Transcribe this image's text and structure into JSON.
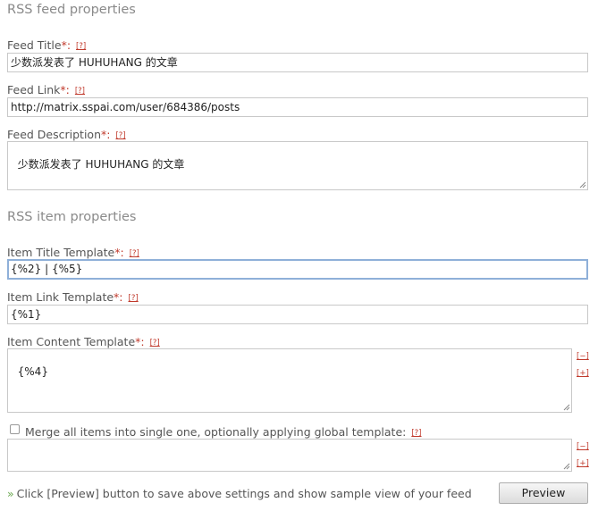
{
  "feed_section": {
    "title": "RSS feed properties",
    "feed_title": {
      "label": "Feed Title",
      "value": "少数派发表了 HUHUHANG 的文章"
    },
    "feed_link": {
      "label": "Feed Link",
      "value": "http://matrix.sspai.com/user/684386/posts"
    },
    "feed_description": {
      "label": "Feed Description",
      "value": "少数派发表了 HUHUHANG 的文章"
    }
  },
  "item_section": {
    "title": "RSS item properties",
    "item_title_template": {
      "label": "Item Title Template",
      "value": "{%2} | {%5}"
    },
    "item_link_template": {
      "label": "Item Link Template",
      "value": "{%1}"
    },
    "item_content_template": {
      "label": "Item Content Template",
      "value": "{%4}"
    }
  },
  "common": {
    "required_mark": "*:",
    "help_link": "[?]",
    "shrink_link": "[−]",
    "expand_link": "[+]"
  },
  "merge": {
    "checked": false,
    "label": "Merge all items into single one, optionally applying global template:",
    "value": ""
  },
  "footer": {
    "arrow": "»",
    "note": "Click [Preview] button to save above settings and show sample view of your feed",
    "preview_label": "Preview"
  }
}
